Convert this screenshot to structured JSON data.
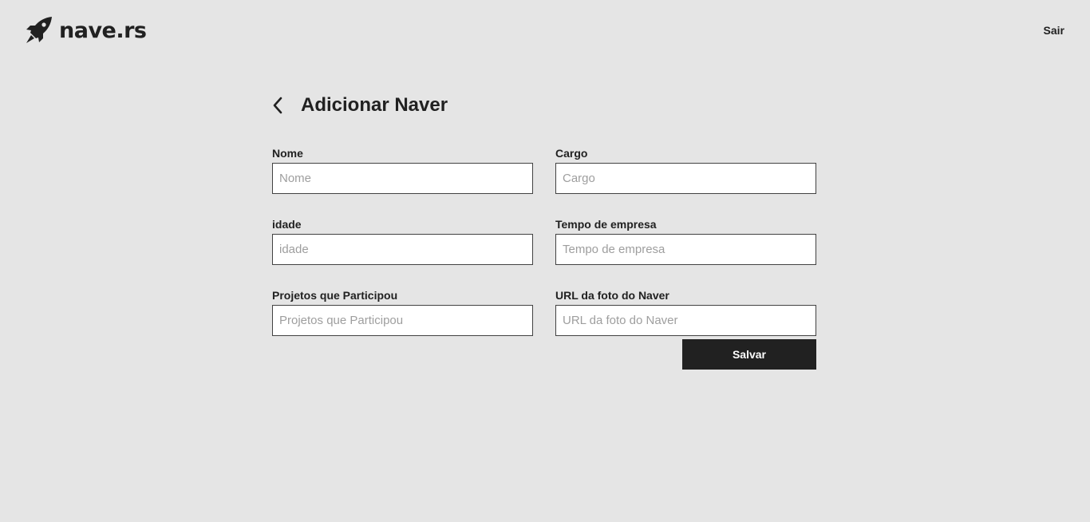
{
  "header": {
    "logo_text": "nave.rs",
    "logo_icon": "rocket-icon",
    "logout_label": "Sair"
  },
  "main": {
    "back_icon": "chevron-left-icon",
    "title": "Adicionar Naver",
    "fields": [
      {
        "label": "Nome",
        "placeholder": "Nome",
        "value": ""
      },
      {
        "label": "Cargo",
        "placeholder": "Cargo",
        "value": ""
      },
      {
        "label": "idade",
        "placeholder": "idade",
        "value": ""
      },
      {
        "label": "Tempo de empresa",
        "placeholder": "Tempo de empresa",
        "value": ""
      },
      {
        "label": "Projetos que Participou",
        "placeholder": "Projetos que Participou",
        "value": ""
      },
      {
        "label": "URL da foto do Naver",
        "placeholder": "URL da foto do Naver",
        "value": ""
      }
    ],
    "save_label": "Salvar"
  },
  "colors": {
    "background": "#e5e5e5",
    "text": "#212121",
    "button_bg": "#212121",
    "button_text": "#ffffff",
    "input_border": "#424242",
    "placeholder": "#9e9e9e"
  }
}
